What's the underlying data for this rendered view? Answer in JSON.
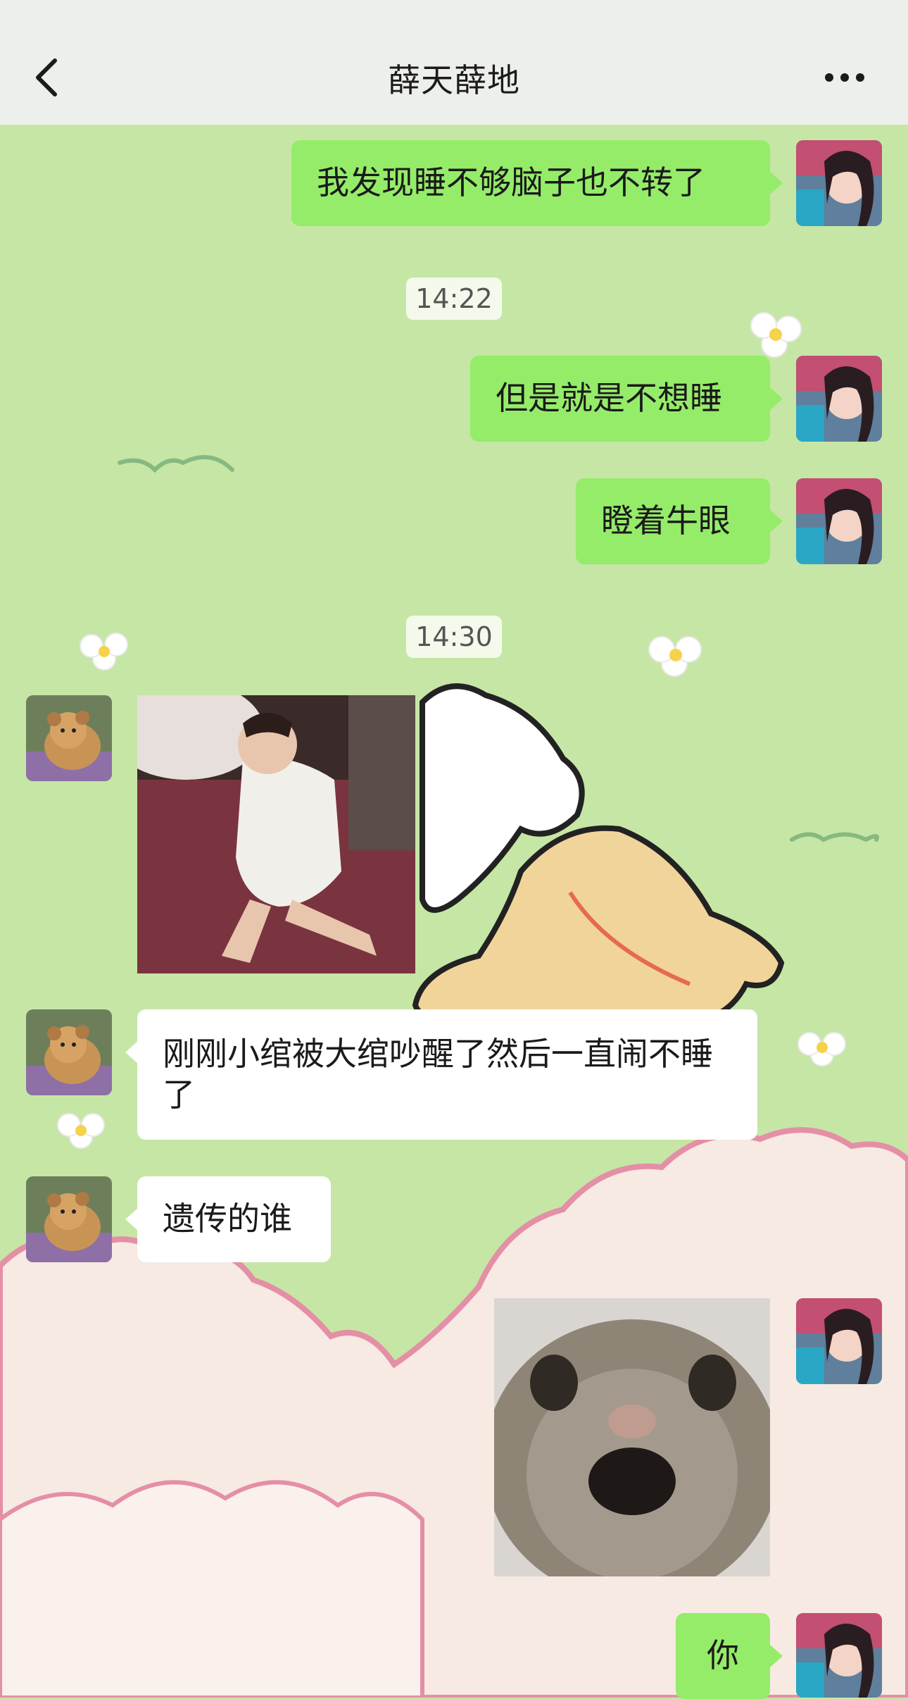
{
  "header": {
    "title": "薛天薛地",
    "back_icon": "chevron-left-icon",
    "more_icon": "more-dots-icon"
  },
  "colors": {
    "outgoing_bubble": "#95ec69",
    "incoming_bubble": "#ffffff",
    "chat_background": "#c6e6a6"
  },
  "messages": {
    "m1": "我发现睡不够脑子也不转了",
    "t1": "14:22",
    "m2": "但是就是不想睡",
    "m3": "瞪着牛眼",
    "t2": "14:30",
    "m5": "刚刚小绾被大绾吵醒了然后一直闹不睡了",
    "m6": "遗传的谁",
    "m8": "你"
  }
}
